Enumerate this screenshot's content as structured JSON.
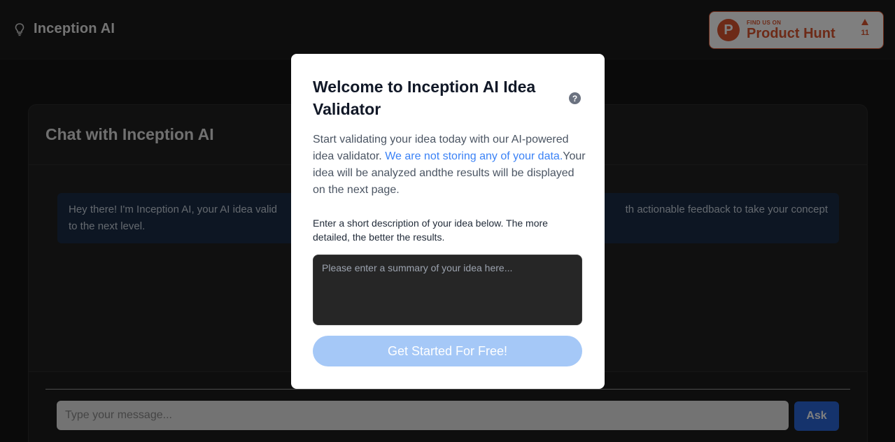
{
  "header": {
    "brand_name": "Inception AI",
    "product_hunt": {
      "small_label": "FIND US ON",
      "big_label": "Product Hunt",
      "logo_letter": "P",
      "votes": "11"
    }
  },
  "chat": {
    "title": "Chat with Inception AI",
    "bot_message_left": "Hey there! I'm Inception AI, your AI idea valid",
    "bot_message_right": "th actionable feedback to take your concept",
    "bot_message_line2": "to the next level.",
    "input_placeholder": "Type your message...",
    "ask_label": "Ask"
  },
  "modal": {
    "title": "Welcome to Inception AI Idea Validator",
    "help_glyph": "?",
    "desc_part1": "Start validating your idea today with our AI-powered idea validator. ",
    "desc_link": "We are not storing any of your data.",
    "desc_part2": "Your idea will be analyzed andthe results will be displayed on the next page.",
    "hint": "Enter a short description of your idea below. The more detailed, the better the results.",
    "idea_placeholder": "Please enter a summary of your idea here...",
    "cta_label": "Get Started For Free!"
  },
  "colors": {
    "accent_blue": "#2a66d9",
    "product_hunt_orange": "#da552f",
    "cta_disabled": "#a5c8f7"
  }
}
